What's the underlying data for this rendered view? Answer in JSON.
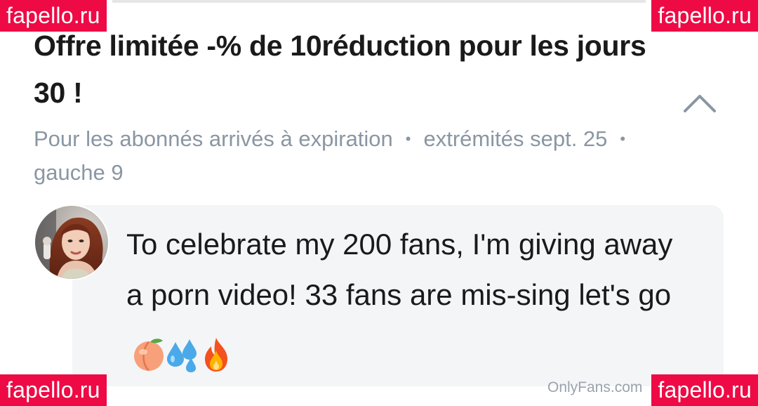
{
  "post": {
    "title": "Offre limitée -% de 10réduction pour les jours 30 !",
    "audience": "Pour les abonnés arrivés à expiration",
    "ends": "extrémités sept. 25",
    "remaining": "gauche 9",
    "collapse_icon": "chevron-up-icon"
  },
  "message": {
    "text": "To celebrate my 200 fans, I'm giving away a porn video! 33 fans are mis-sing let's go",
    "emojis": [
      "peach-emoji",
      "sweat-droplets-emoji",
      "fire-emoji"
    ]
  },
  "watermarks": {
    "top_left": "fapello.ru",
    "top_right": "fapello.ru",
    "bottom_left": "fapello.ru",
    "bottom_right": "fapello.ru"
  },
  "footer": {
    "credit": "OnlyFans.com"
  },
  "colors": {
    "watermark_bg": "#ee0a45",
    "meta_text": "#8a96a3",
    "bubble_bg": "#f3f5f7",
    "title_text": "#1a1a1a"
  }
}
